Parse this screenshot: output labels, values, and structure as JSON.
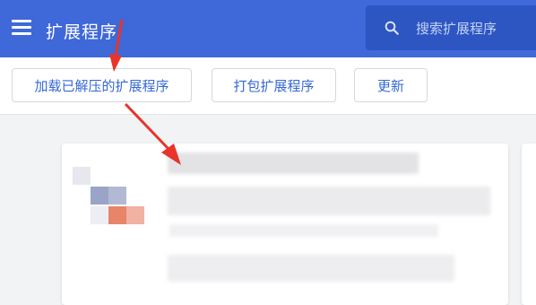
{
  "header": {
    "title": "扩展程序",
    "menu_icon": "hamburger-menu-icon",
    "search": {
      "icon": "search-icon",
      "placeholder": "搜索扩展程序"
    }
  },
  "toolbar": {
    "load_unpacked_label": "加载已解压的扩展程序",
    "pack_label": "打包扩展程序",
    "update_label": "更新"
  },
  "colors": {
    "header_bg": "#3f68d8",
    "search_bg": "#2d56c3",
    "button_text": "#3568d4",
    "annotation_arrow": "#e8342a"
  }
}
